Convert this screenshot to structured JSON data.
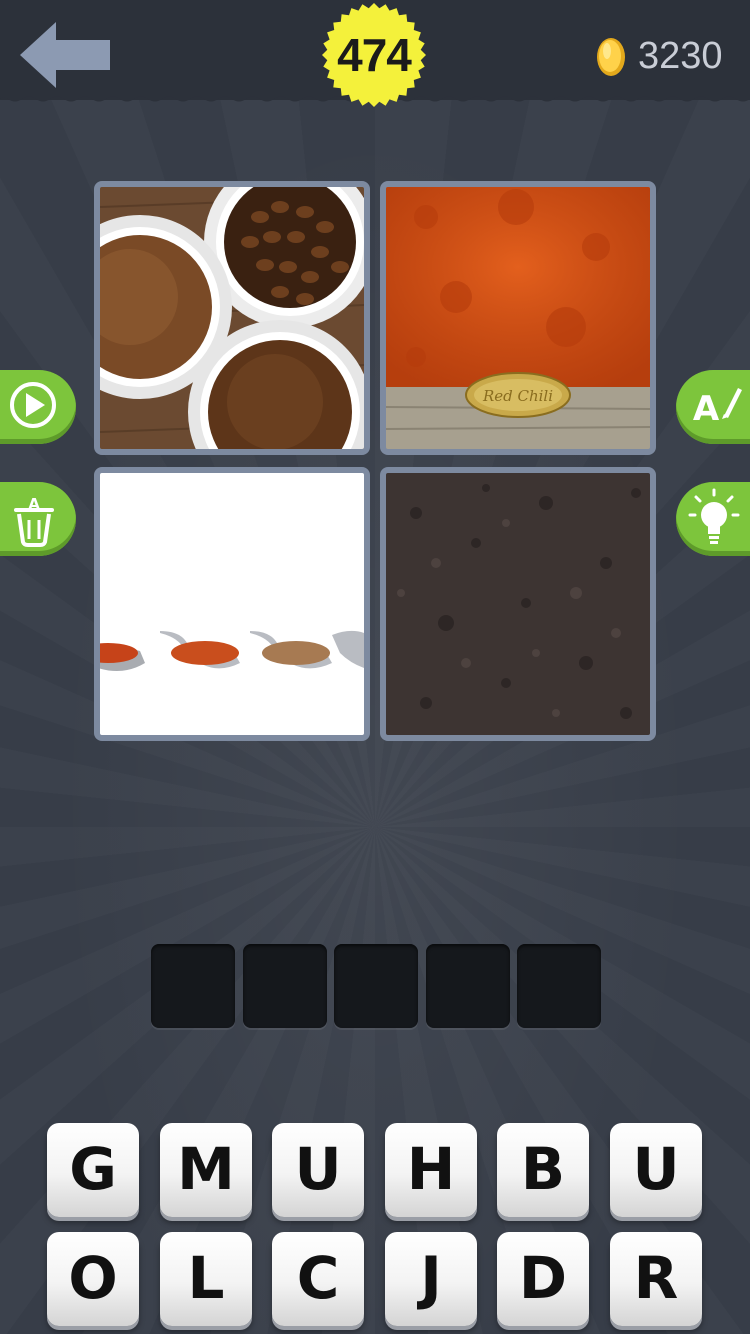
{
  "header": {
    "level": "474",
    "coins": "3230",
    "back_icon": "back-arrow-icon",
    "coin_icon": "gold-coin-icon"
  },
  "photos": [
    {
      "name": "coffee-bowls-photo",
      "sign_text": ""
    },
    {
      "name": "red-chili-powder-photo",
      "sign_text": "Red Chili"
    },
    {
      "name": "spice-spoons-photo",
      "sign_text": ""
    },
    {
      "name": "brown-powder-photo",
      "sign_text": ""
    }
  ],
  "side_buttons": {
    "left": [
      "play-icon",
      "trash-letter-icon"
    ],
    "right": [
      "reveal-letter-icon",
      "lightbulb-hint-icon"
    ]
  },
  "answer": {
    "length": 5,
    "slots": [
      "",
      "",
      "",
      "",
      ""
    ]
  },
  "keyboard": {
    "row1": [
      "G",
      "M",
      "U",
      "H",
      "B",
      "U"
    ],
    "row2": [
      "O",
      "L",
      "C",
      "J",
      "D",
      "R"
    ]
  },
  "colors": {
    "background": "#373d48",
    "topbar": "#2c313a",
    "level_badge": "#f4f13b",
    "button_green": "#7dc53c",
    "tile_border": "#7d8aa0",
    "slot": "#15181c"
  }
}
